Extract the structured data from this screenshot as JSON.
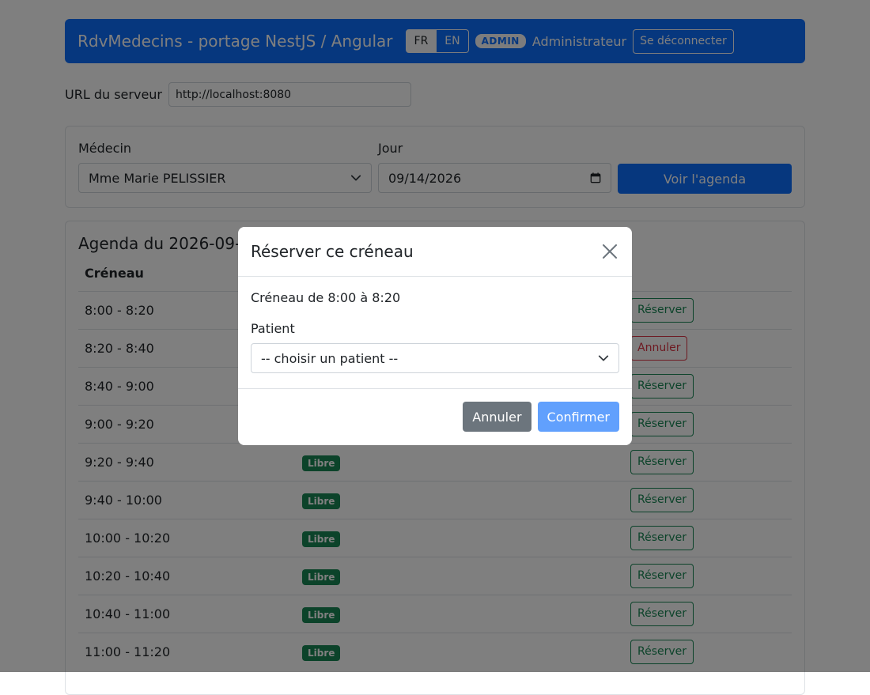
{
  "navbar": {
    "brand": "RdvMedecins - portage NestJS / Angular",
    "lang_fr": "FR",
    "lang_en": "EN",
    "role_badge": "ADMIN",
    "user": "Administrateur",
    "logout": "Se déconnecter"
  },
  "server": {
    "label": "URL du serveur",
    "url": "http://localhost:8080"
  },
  "form": {
    "doctor_label": "Médecin",
    "doctor_value": "Mme Marie PELISSIER",
    "day_label": "Jour",
    "day_value": "09/14/2026",
    "submit": "Voir l'agenda"
  },
  "agenda": {
    "title": "Agenda du 2026-09-",
    "col_slot": "Créneau",
    "free_label": "Libre",
    "reserve_label": "Réserver",
    "cancel_label": "Annuler",
    "rows": [
      {
        "slot": "8:00 - 8:20"
      },
      {
        "slot": "8:20 - 8:40"
      },
      {
        "slot": "8:40 - 9:00"
      },
      {
        "slot": "9:00 - 9:20"
      },
      {
        "slot": "9:20 - 9:40"
      },
      {
        "slot": "9:40 - 10:00"
      },
      {
        "slot": "10:00 - 10:20"
      },
      {
        "slot": "10:20 - 10:40"
      },
      {
        "slot": "10:40 - 11:00"
      },
      {
        "slot": "11:00 - 11:20"
      }
    ]
  },
  "modal": {
    "title": "Réserver ce créneau",
    "slot_text": "Créneau de 8:00 à 8:20",
    "patient_label": "Patient",
    "patient_placeholder": "-- choisir un patient --",
    "cancel": "Annuler",
    "confirm": "Confirmer"
  },
  "colors": {
    "primary": "#0d6efd",
    "success": "#198754",
    "danger": "#dc3545",
    "secondary": "#6c757d"
  }
}
